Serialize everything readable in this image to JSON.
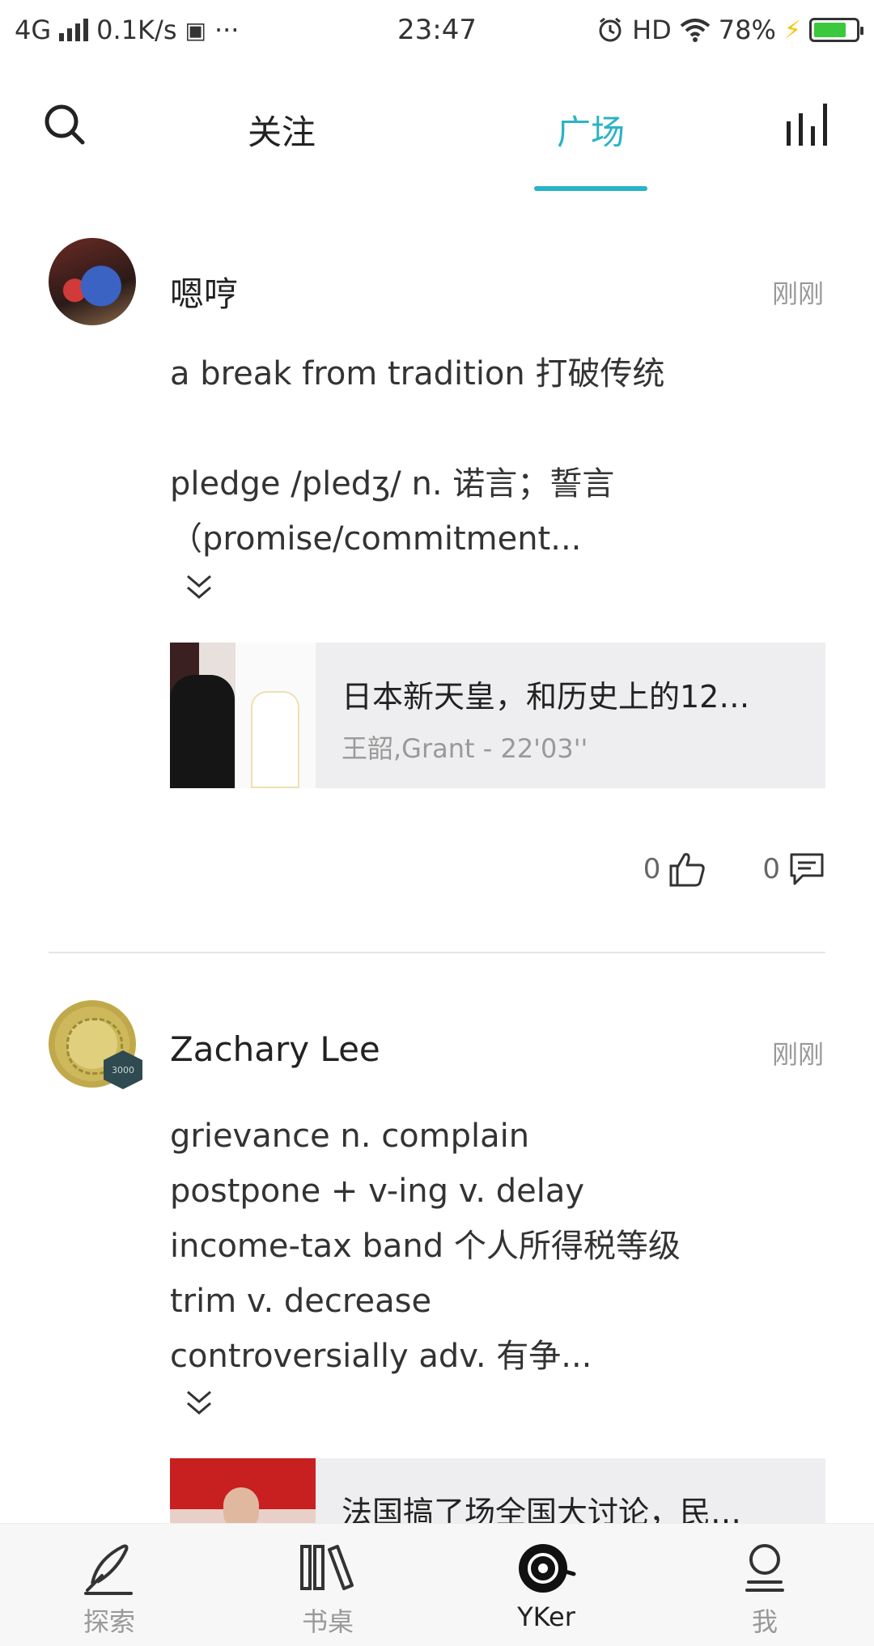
{
  "status_bar": {
    "network": "4G",
    "speed": "0.1K/s",
    "more": "···",
    "time": "23:47",
    "hd": "HD",
    "battery": "78%",
    "battery_level": 0.78
  },
  "tabs": {
    "follow": "关注",
    "square": "广场",
    "active": "square"
  },
  "colors": {
    "accent": "#2bb3c6",
    "battery_green": "#3cc83c"
  },
  "posts": [
    {
      "username": "嗯哼",
      "time": "刚刚",
      "text": "a break from tradition 打破传统\n\npledge /pledʒ/ n. 诺言；誓言\n（promise/commitment...",
      "media": {
        "title": "日本新天皇，和历史上的12…",
        "subtitle": "王韶,Grant   - 22'03''"
      },
      "likes": "0",
      "comments": "0"
    },
    {
      "username": "Zachary Lee",
      "badge": "3000",
      "time": "刚刚",
      "text": "grievance n. complain\npostpone + v-ing v. delay\nincome-tax band 个人所得税等级\ntrim v. decrease\ncontroversially adv. 有争...",
      "media": {
        "title": "法国搞了场全国大讨论，民…"
      }
    }
  ],
  "bottom_nav": {
    "explore": "探索",
    "desk": "书桌",
    "yker": "YKer",
    "me": "我",
    "active": "yker"
  },
  "icons": {
    "search": "search-icon",
    "stats": "bar-chart-icon",
    "expand": "double-chevron-down-icon",
    "like": "thumbs-up-icon",
    "comment": "comment-icon",
    "explore": "quill-icon",
    "desk": "bookshelf-icon",
    "yker": "vinyl-disc-icon",
    "me": "user-icon"
  }
}
